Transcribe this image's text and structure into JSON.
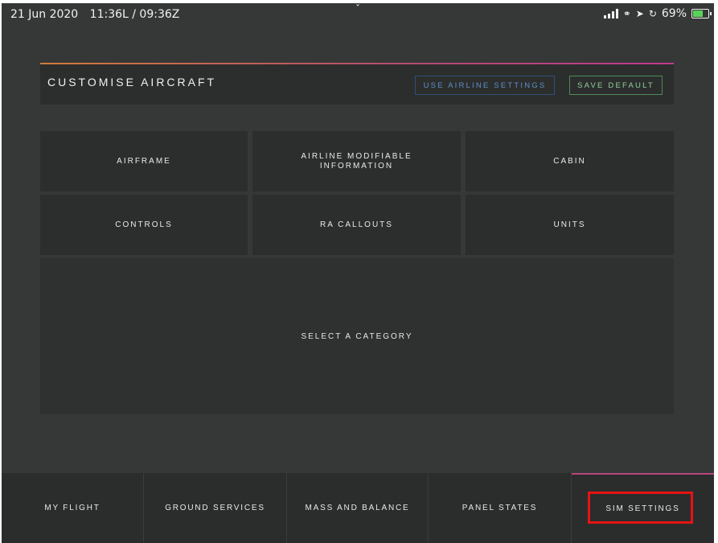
{
  "status_bar": {
    "date": "21 Jun 2020",
    "time": "11:36L / 09:36Z",
    "battery": "69%",
    "battery_level": 0.69,
    "chevron": "ˇ"
  },
  "header": {
    "title": "CUSTOMISE AIRCRAFT",
    "use_airline_label": "USE AIRLINE SETTINGS",
    "save_default_label": "SAVE DEFAULT"
  },
  "categories": [
    {
      "label": "AIRFRAME"
    },
    {
      "label": "AIRLINE MODIFIABLE INFORMATION"
    },
    {
      "label": "CABIN"
    },
    {
      "label": "CONTROLS"
    },
    {
      "label": "RA CALLOUTS"
    },
    {
      "label": "UNITS"
    }
  ],
  "content": {
    "placeholder": "SELECT A CATEGORY"
  },
  "nav": {
    "items": [
      {
        "label": "MY FLIGHT"
      },
      {
        "label": "GROUND SERVICES"
      },
      {
        "label": "MASS AND BALANCE"
      },
      {
        "label": "PANEL STATES"
      },
      {
        "label": "SIM SETTINGS"
      }
    ],
    "active_index": 4
  },
  "colors": {
    "background": "#353836",
    "panel": "#2c2e2d",
    "accent_gradient_start": "#d07b3a",
    "accent_gradient_end": "#c2388f",
    "airline_button": "#5f8fc8",
    "save_button": "#8fd09c",
    "highlight": "#e41414"
  }
}
